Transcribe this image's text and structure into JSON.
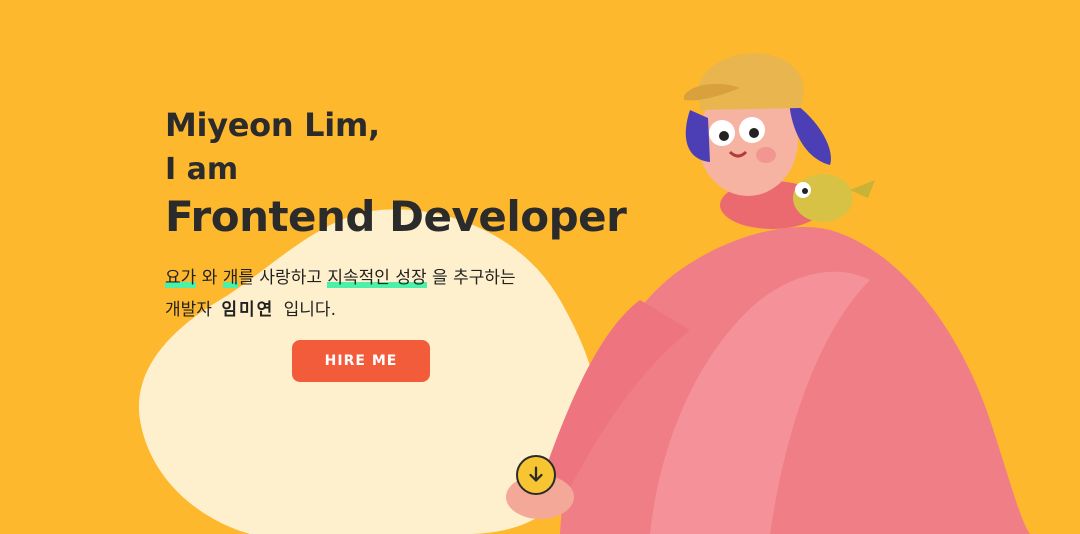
{
  "hero": {
    "name_line": "Miyeon Lim,",
    "iam_line": "I am",
    "role_line": "Frontend Developer"
  },
  "intro": {
    "p1": "요가",
    "p2": "와",
    "p3": "개",
    "p4": "를 사랑하고",
    "p5": "지속적인 성장",
    "p6": "을 추구하는",
    "p7": "개발자",
    "p8": "임미연",
    "p9": "입니다."
  },
  "cta": {
    "label": "HIRE ME"
  },
  "icons": {
    "scroll": "arrow-down-circle-icon"
  },
  "colors": {
    "background": "#FDB82E",
    "blob": "#FEF0CC",
    "button": "#F25C3A",
    "highlight": "#4CF0A8",
    "text": "#2b2b2b"
  }
}
